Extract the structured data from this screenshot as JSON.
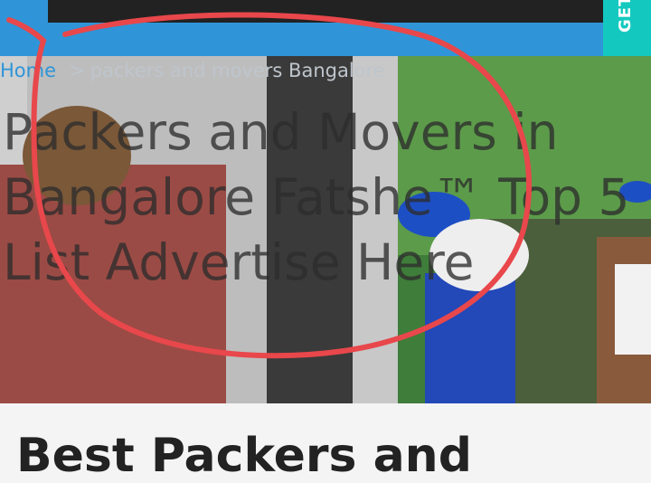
{
  "header": {
    "cta_label": "GET"
  },
  "breadcrumb": {
    "home": "Home",
    "separator": ">",
    "current": "packers and movers Bangalore"
  },
  "hero": {
    "title": "Packers and Movers in Bangalore Fatshe™ Top 5 List Advertise Here"
  },
  "content": {
    "heading": "Best Packers and"
  },
  "colors": {
    "header": "#2f95d8",
    "cta": "#13c9bf",
    "annotation": "#e8474b"
  }
}
